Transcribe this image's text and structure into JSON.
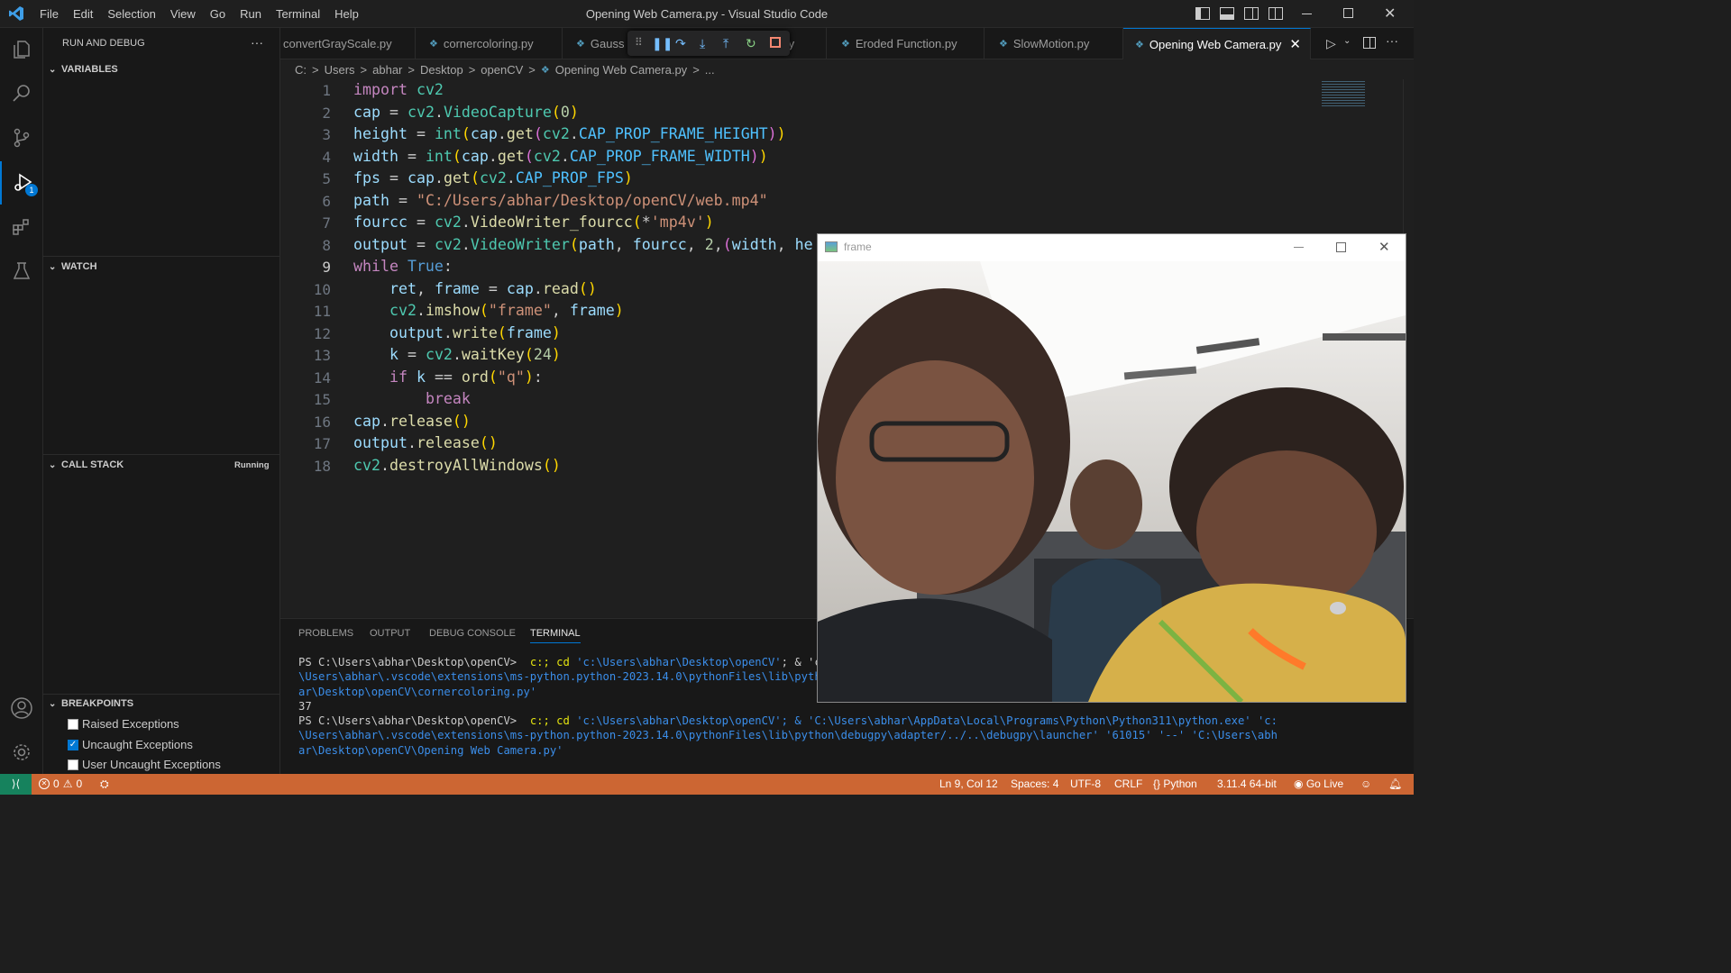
{
  "app": {
    "title": "Opening Web Camera.py - Visual Studio Code",
    "menu": [
      "File",
      "Edit",
      "Selection",
      "View",
      "Go",
      "Run",
      "Terminal",
      "Help"
    ]
  },
  "activity": {
    "debug_badge": "1"
  },
  "sidebar": {
    "header": "RUN AND DEBUG",
    "more": "···",
    "variables": "VARIABLES",
    "watch": "WATCH",
    "callstack": "CALL STACK",
    "callstack_status": "Running",
    "breakpoints": "BREAKPOINTS",
    "breakpoint_items": [
      {
        "label": "Raised Exceptions",
        "checked": false
      },
      {
        "label": "Uncaught Exceptions",
        "checked": true
      },
      {
        "label": "User Uncaught Exceptions",
        "checked": false
      }
    ]
  },
  "tabs": [
    {
      "label": "convertGrayScale.py"
    },
    {
      "label": "cornercoloring.py"
    },
    {
      "label": "Gauss"
    },
    {
      "label": "py"
    },
    {
      "label": "Eroded Function.py"
    },
    {
      "label": "SlowMotion.py"
    },
    {
      "label": "Opening Web Camera.py",
      "active": true
    }
  ],
  "breadcrumb": [
    "C:",
    ">",
    "Users",
    ">",
    "abhar",
    ">",
    "Desktop",
    ">",
    "openCV",
    ">",
    "Opening Web Camera.py",
    ">",
    "..."
  ],
  "editor": {
    "current_line": 9,
    "line_numbers": [
      "1",
      "2",
      "3",
      "4",
      "5",
      "6",
      "7",
      "8",
      "9",
      "10",
      "11",
      "12",
      "13",
      "14",
      "15",
      "16",
      "17",
      "18"
    ]
  },
  "panel": {
    "tabs": [
      "PROBLEMS",
      "OUTPUT",
      "DEBUG CONSOLE",
      "TERMINAL"
    ],
    "active_tab": "TERMINAL",
    "terminal": [
      {
        "prompt": "PS C:\\Users\\abhar\\Desktop\\openCV> ",
        "cmd": " c:; cd ",
        "arg": "'c:\\Users\\abhar\\Desktop\\openCV'",
        "rest": "; & 'c"
      },
      {
        "text": "\\Users\\abhar\\.vscode\\extensions\\ms-python.python-2023.14.0\\pythonFiles\\lib\\pyth"
      },
      {
        "text": "ar\\Desktop\\openCV\\cornercoloring.py'"
      },
      {
        "plain": "37"
      },
      {
        "prompt": "PS C:\\Users\\abhar\\Desktop\\openCV> ",
        "cmd": " c:; cd ",
        "arg": "'c:\\Users\\abhar\\Desktop\\openCV'",
        "rest": "; & 'C:\\Users\\abhar\\AppData\\Local\\Programs\\Python\\Python311\\python.exe' 'c:"
      },
      {
        "text": "\\Users\\abhar\\.vscode\\extensions\\ms-python.python-2023.14.0\\pythonFiles\\lib\\python\\debugpy\\adapter/../..\\debugpy\\launcher' '61015' '--' 'C:\\Users\\abh"
      },
      {
        "text": "ar\\Desktop\\openCV\\Opening Web Camera.py'"
      }
    ]
  },
  "frame_window": {
    "title": "frame"
  },
  "status": {
    "errors": "0",
    "warnings": "0",
    "position": "Ln 9, Col 12",
    "spaces": "Spaces: 4",
    "encoding": "UTF-8",
    "eol": "CRLF",
    "language": "Python",
    "interpreter": "3.11.4 64-bit",
    "golive": "Go Live"
  },
  "colors": {
    "statusbar": "#cc6633",
    "accent": "#0078d4"
  }
}
